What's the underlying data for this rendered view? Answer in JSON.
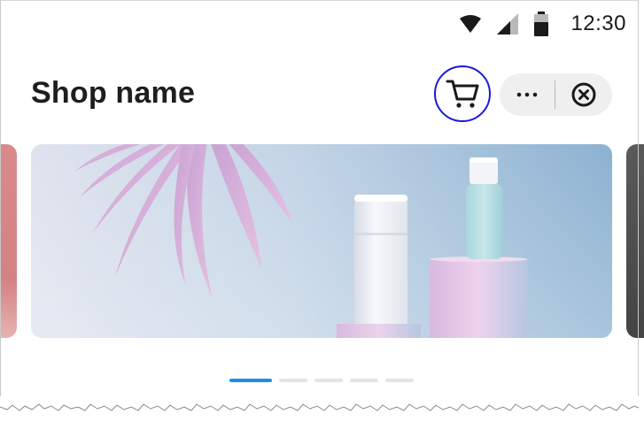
{
  "status_bar": {
    "time": "12:30",
    "icons": [
      "wifi-icon",
      "cellular-signal-icon",
      "battery-icon"
    ]
  },
  "header": {
    "title": "Shop name",
    "cart_icon": "cart-icon",
    "more_icon": "more-icon",
    "close_icon": "close-circle-icon"
  },
  "carousel": {
    "slide_count": 5,
    "active_index": 0
  },
  "colors": {
    "accent": "#1a8ef0",
    "focus_ring": "#1a1adb",
    "title": "#1e1e1e",
    "capsule_bg": "#efefef"
  }
}
